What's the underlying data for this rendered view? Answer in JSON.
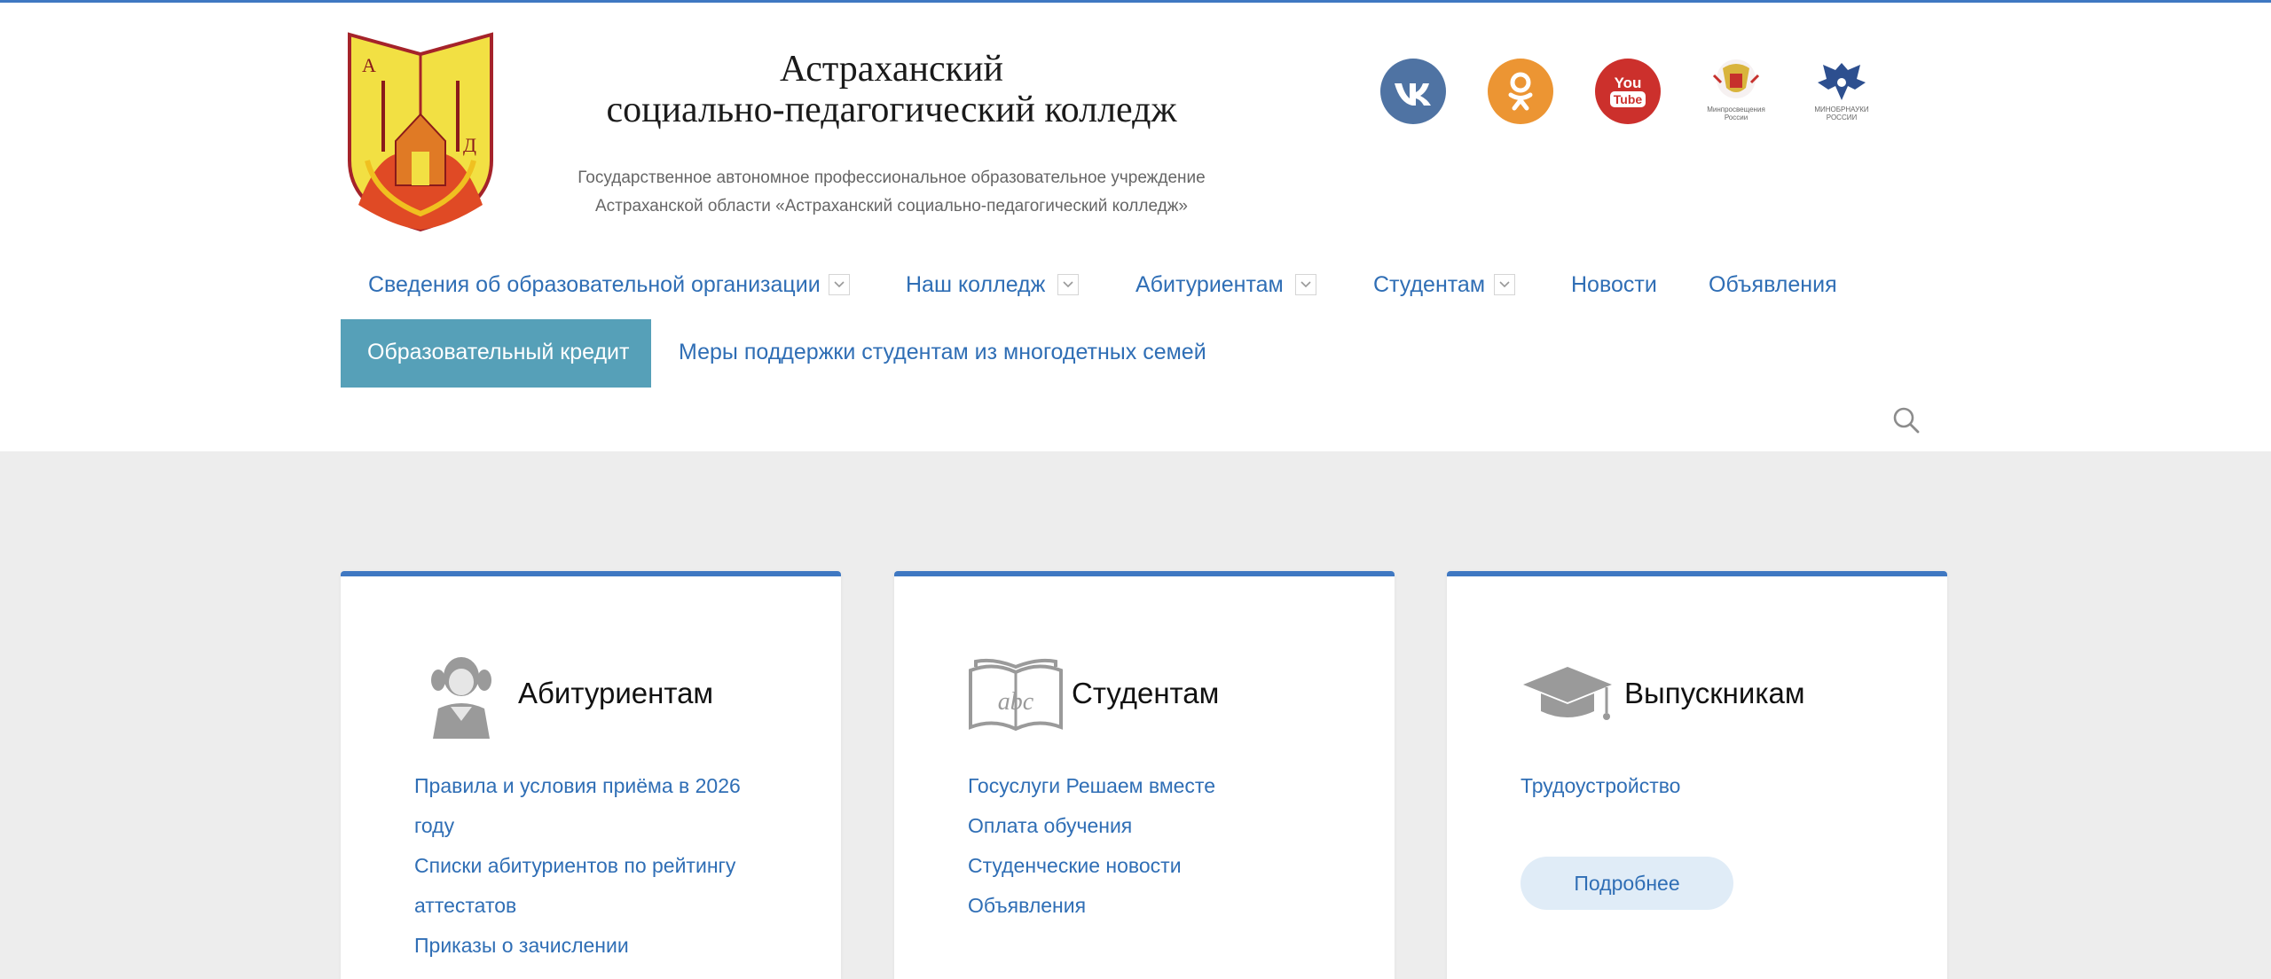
{
  "header": {
    "title_line1": "Астраханский",
    "title_line2": "социально-педагогический колледж",
    "subtitle_line1": "Государственное автономное профессиональное образовательное учреждение",
    "subtitle_line2": "Астраханской области «Астраханский социально-педагогический колледж»",
    "logo_letter_left": "А",
    "logo_letter_right": "Д"
  },
  "social": {
    "youtube_label_top": "You",
    "youtube_label_bottom": "Tube",
    "minpros_caption": "Минпросвещения России",
    "minobr_caption": "МИНОБРНАУКИ РОССИИ"
  },
  "nav": {
    "items": [
      {
        "label": "Сведения об образовательной организации",
        "has_dropdown": true
      },
      {
        "label": "Наш колледж",
        "has_dropdown": true
      },
      {
        "label": "Абитуриентам",
        "has_dropdown": true
      },
      {
        "label": "Студентам",
        "has_dropdown": true
      },
      {
        "label": "Новости",
        "has_dropdown": false
      },
      {
        "label": "Объявления",
        "has_dropdown": false
      },
      {
        "label": "Образовательный кредит",
        "active": true
      },
      {
        "label": "Меры поддержки студентам из многодетных семей",
        "has_dropdown": false
      }
    ]
  },
  "cards": [
    {
      "title": "Абитуриентам",
      "icon": "girl-icon",
      "links": [
        "Правила и условия приёма в 2026",
        "году",
        "Списки абитуриентов по рейтингу",
        "аттестатов",
        "Приказы о зачислении"
      ]
    },
    {
      "title": "Студентам",
      "icon": "open-book-icon",
      "icon_text": "abc",
      "links": [
        "Госуслуги Решаем вместе",
        "Оплата обучения",
        "Студенческие новости",
        "Объявления"
      ]
    },
    {
      "title": "Выпускникам",
      "icon": "graduation-cap-icon",
      "links": [
        "Трудоустройство"
      ],
      "button": "Подробнее"
    }
  ],
  "colors": {
    "accent": "#3f78c2",
    "link": "#2f6eb5",
    "active_nav": "#56a0b8",
    "background": "#ededed"
  }
}
